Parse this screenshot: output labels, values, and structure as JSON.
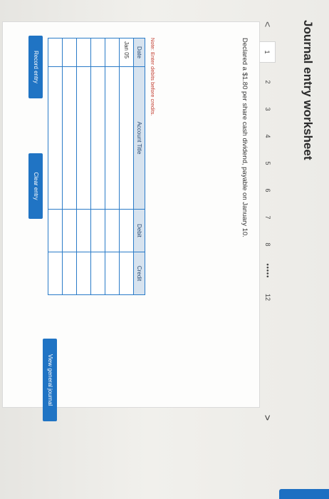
{
  "worksheet": {
    "title": "Journal entry worksheet",
    "prev_arrow": "<",
    "next_arrow": ">",
    "pages": [
      "1",
      "2",
      "3",
      "4",
      "5",
      "6",
      "7",
      "8"
    ],
    "ellipsis": "•••••",
    "last_page": "12",
    "active_page": "1",
    "prompt": "Declared a $1.80 per share cash dividend, payable on January 10.",
    "note": "Note: Enter debits before credits.",
    "table": {
      "headers": {
        "date": "Date",
        "account": "Account Title",
        "debit": "Debit",
        "credit": "Credit"
      },
      "rows": [
        {
          "date": "Jan 05"
        },
        {
          "date": ""
        },
        {
          "date": ""
        },
        {
          "date": ""
        },
        {
          "date": ""
        },
        {
          "date": ""
        }
      ]
    },
    "buttons": {
      "record": "Record entry",
      "clear": "Clear entry",
      "view_journal": "View general journal"
    }
  }
}
